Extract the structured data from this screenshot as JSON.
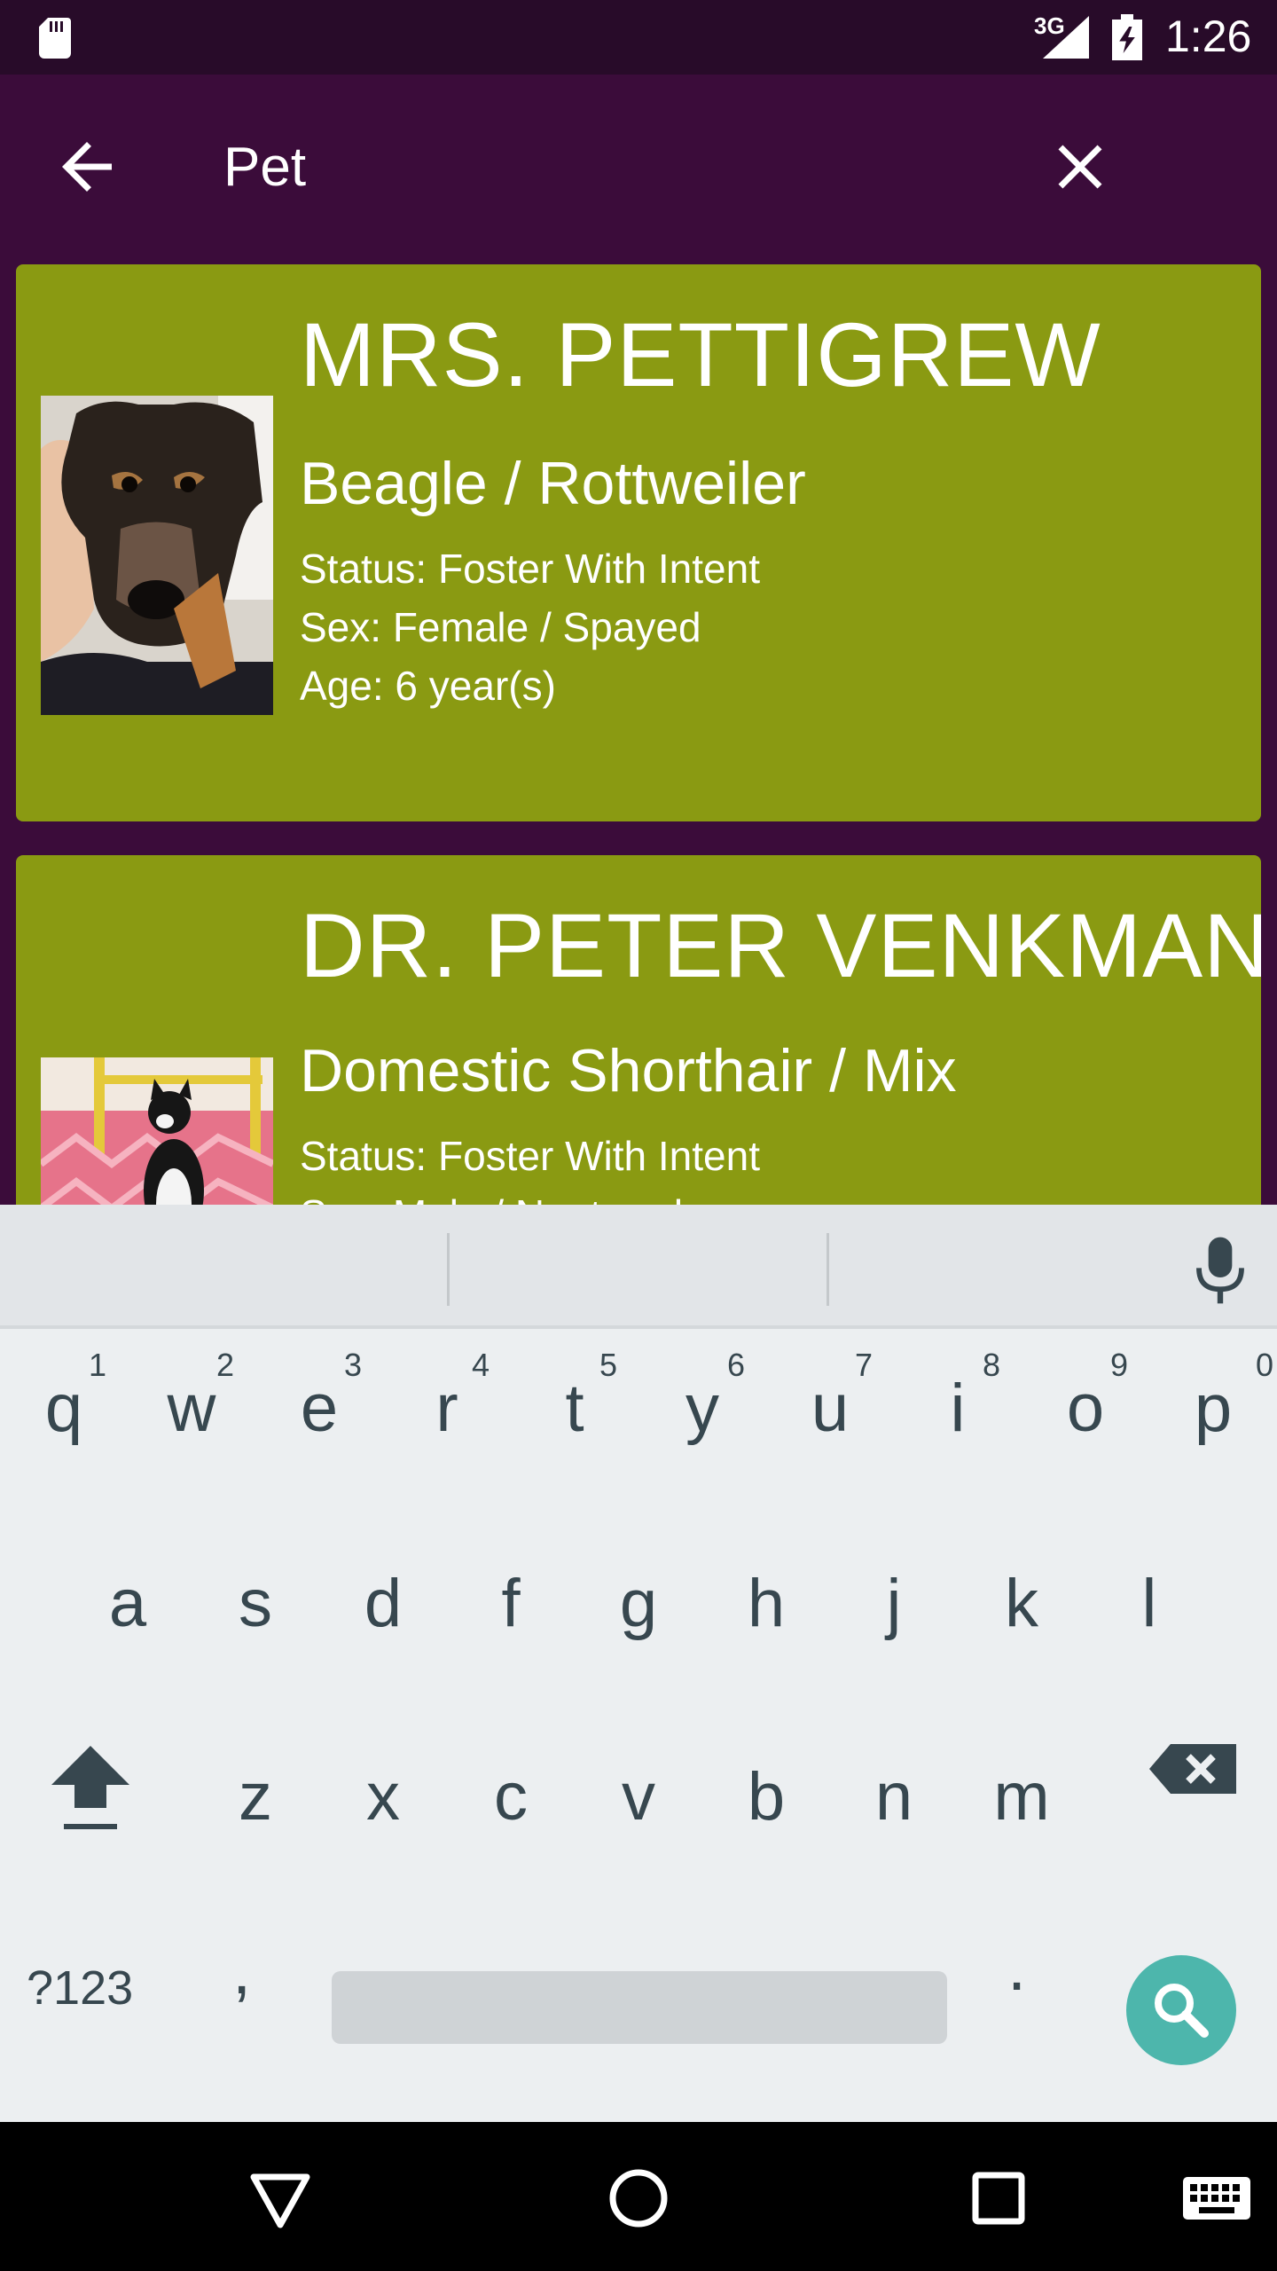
{
  "status_bar": {
    "network": "3G",
    "time": "1:26",
    "icons": [
      "sd-card-icon",
      "signal-icon",
      "battery-charging-icon"
    ]
  },
  "toolbar": {
    "back_icon": "arrow-back-icon",
    "search_value": "Pet",
    "clear_icon": "close-icon"
  },
  "results": [
    {
      "name": "MRS. PETTIGREW",
      "breed": "Beagle / Rottweiler",
      "status": "Status: Foster With Intent",
      "sex": "Sex: Female / Spayed",
      "age": "Age: 6 year(s)"
    },
    {
      "name": "DR. PETER VENKMAN",
      "breed": "Domestic Shorthair / Mix",
      "status": "Status: Foster With Intent",
      "sex": "Sex: Male / Neutered"
    }
  ],
  "keyboard": {
    "row1": [
      {
        "ch": "q",
        "num": "1"
      },
      {
        "ch": "w",
        "num": "2"
      },
      {
        "ch": "e",
        "num": "3"
      },
      {
        "ch": "r",
        "num": "4"
      },
      {
        "ch": "t",
        "num": "5"
      },
      {
        "ch": "y",
        "num": "6"
      },
      {
        "ch": "u",
        "num": "7"
      },
      {
        "ch": "i",
        "num": "8"
      },
      {
        "ch": "o",
        "num": "9"
      },
      {
        "ch": "p",
        "num": "0"
      }
    ],
    "row2": [
      "a",
      "s",
      "d",
      "f",
      "g",
      "h",
      "j",
      "k",
      "l"
    ],
    "row3": [
      "z",
      "x",
      "c",
      "v",
      "b",
      "n",
      "m"
    ],
    "symbols_label": "?123",
    "comma": ",",
    "period": "."
  },
  "colors": {
    "toolbar": "#3b0c3a",
    "status_bar": "#280b29",
    "card": "#8a9a12",
    "search_key": "#4db6ac"
  }
}
